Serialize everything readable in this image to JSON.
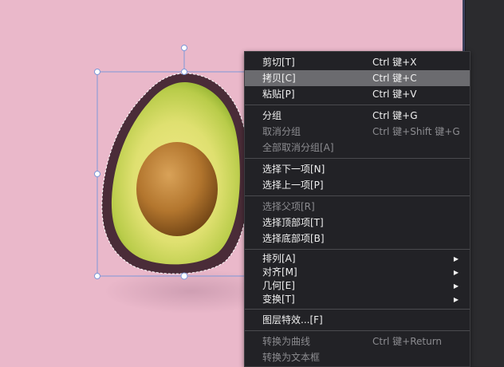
{
  "colors": {
    "background": "#eab8ca",
    "menu_bg": "#222226",
    "menu_highlight": "#6b6b6f",
    "selection_handle": "#7d98d8"
  },
  "context_menu": {
    "items": [
      {
        "label": "剪切[T]",
        "shortcut": "Ctrl 键+X",
        "disabled": false,
        "submenu": false
      },
      {
        "label": "拷贝[C]",
        "shortcut": "Ctrl 键+C",
        "disabled": false,
        "submenu": false,
        "highlighted": true
      },
      {
        "label": "粘贴[P]",
        "shortcut": "Ctrl 键+V",
        "disabled": false,
        "submenu": false
      },
      {
        "label": "分组",
        "shortcut": "Ctrl 键+G",
        "disabled": false,
        "submenu": false
      },
      {
        "label": "取消分组",
        "shortcut": "Ctrl 键+Shift 键+G",
        "disabled": true,
        "submenu": false
      },
      {
        "label": "全部取消分组[A]",
        "shortcut": "",
        "disabled": true,
        "submenu": false
      },
      {
        "label": "选择下一项[N]",
        "shortcut": "",
        "disabled": false,
        "submenu": false
      },
      {
        "label": "选择上一项[P]",
        "shortcut": "",
        "disabled": false,
        "submenu": false
      },
      {
        "label": "选择父项[R]",
        "shortcut": "",
        "disabled": true,
        "submenu": false
      },
      {
        "label": "选择顶部项[T]",
        "shortcut": "",
        "disabled": false,
        "submenu": false
      },
      {
        "label": "选择底部项[B]",
        "shortcut": "",
        "disabled": false,
        "submenu": false
      },
      {
        "label": "排列[A]",
        "shortcut": "",
        "disabled": false,
        "submenu": true
      },
      {
        "label": "对齐[M]",
        "shortcut": "",
        "disabled": false,
        "submenu": true
      },
      {
        "label": "几何[E]",
        "shortcut": "",
        "disabled": false,
        "submenu": true
      },
      {
        "label": "变换[T]",
        "shortcut": "",
        "disabled": false,
        "submenu": true
      },
      {
        "label": "图层特效...[F]",
        "shortcut": "",
        "disabled": false,
        "submenu": false
      },
      {
        "label": "转换为曲线",
        "shortcut": "Ctrl 键+Return",
        "disabled": true,
        "submenu": false
      },
      {
        "label": "转换为文本框",
        "shortcut": "",
        "disabled": true,
        "submenu": false
      }
    ],
    "submenu_arrow_icon": "chevron-right-icon"
  }
}
